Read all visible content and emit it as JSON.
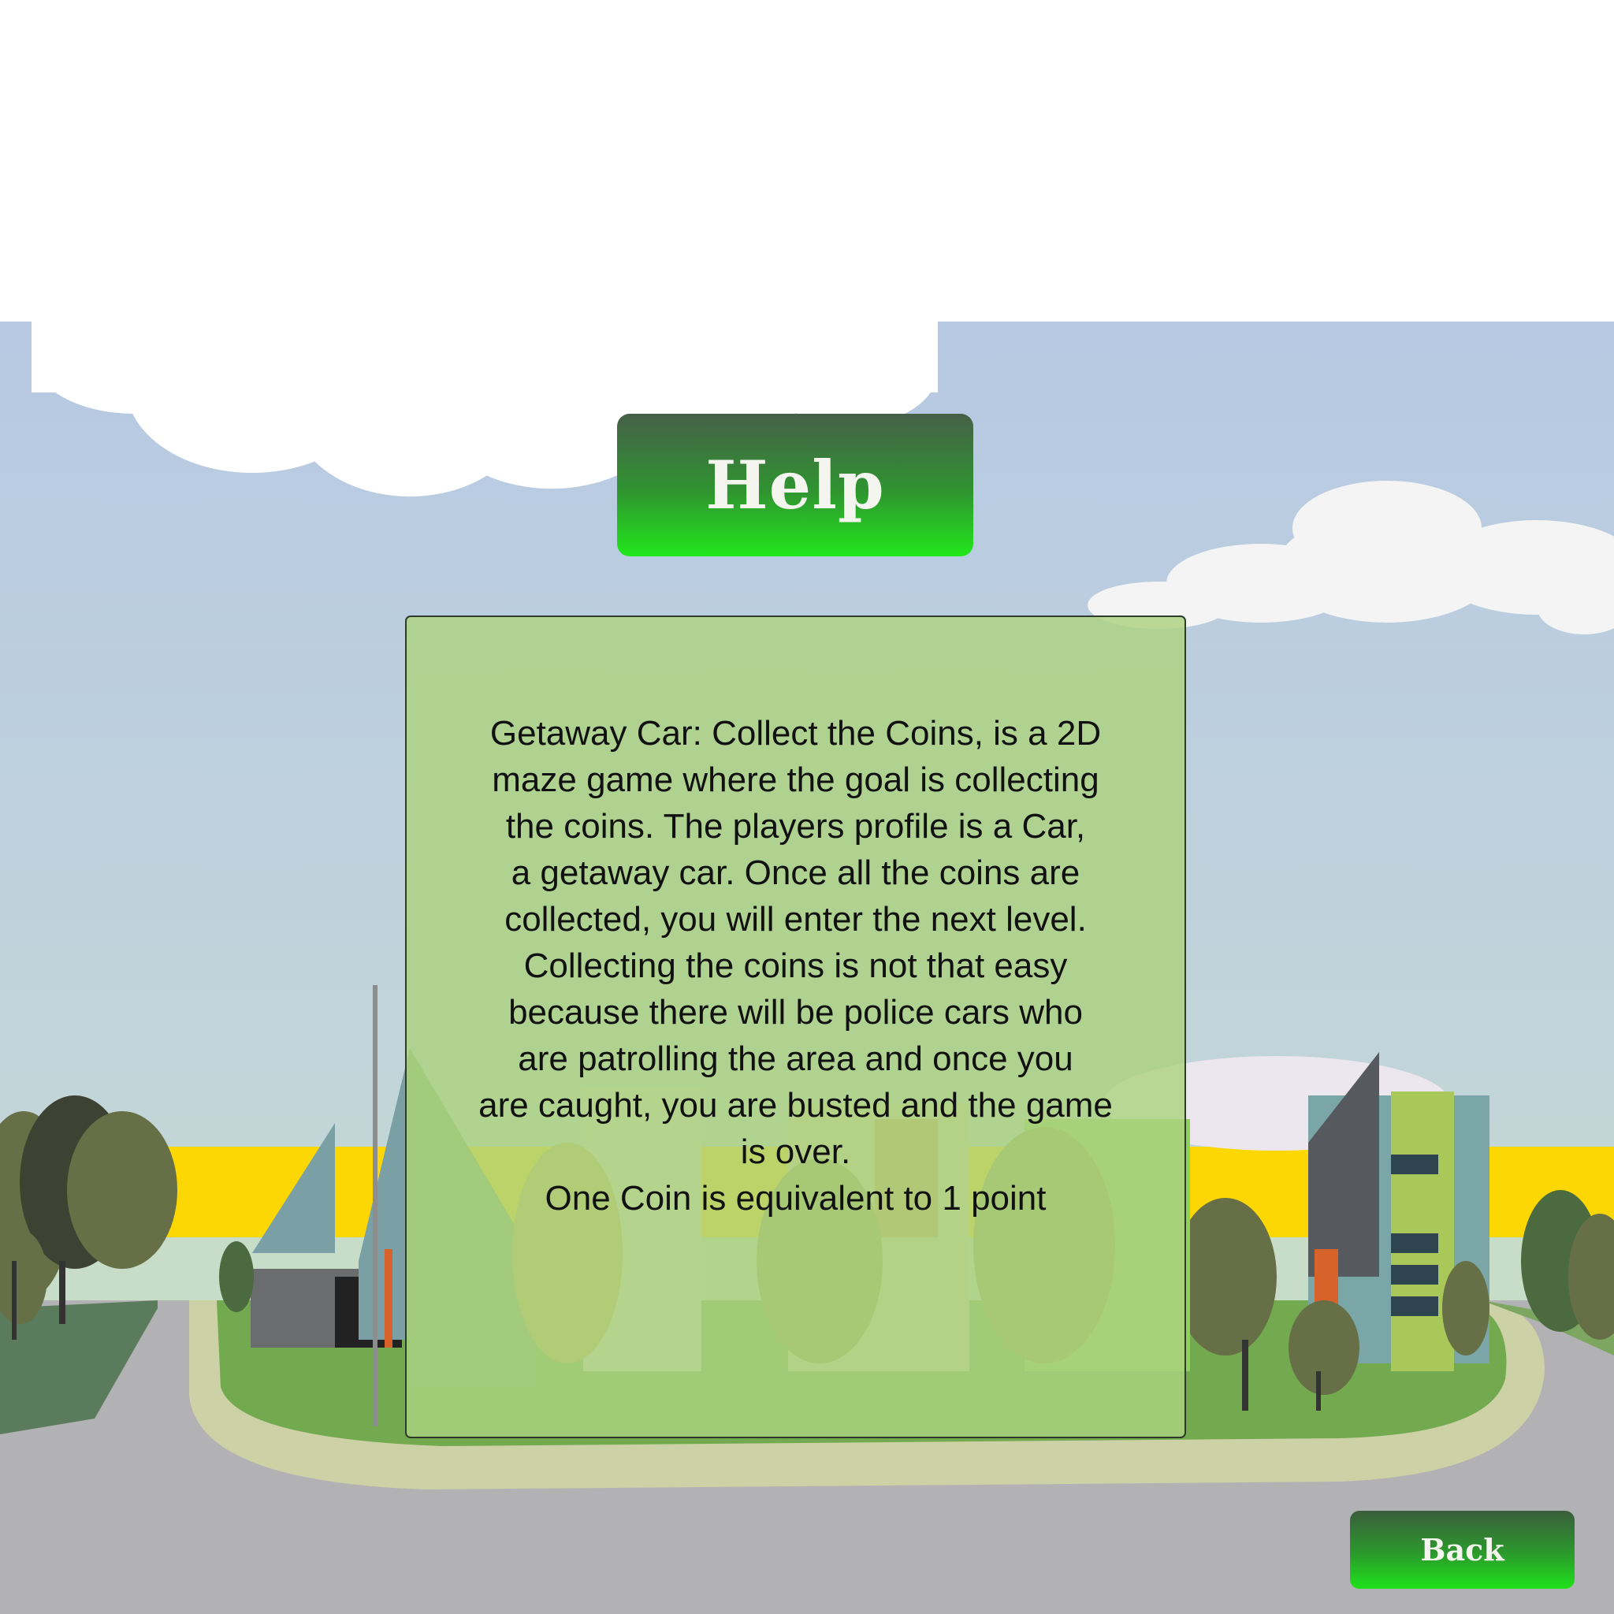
{
  "screen": {
    "title": "Help",
    "help_text": "Getaway Car: Collect the Coins, is a 2D\nmaze game where the goal is collecting\nthe coins. The players profile is a Car,\na getaway car. Once all the coins  are\ncollected, you will enter the next level.\nCollecting the coins is not that easy\nbecause there will be police cars who\nare patrolling the area and once you\nare caught, you are busted and the game\nis over.\nOne Coin is equivalent to 1 point",
    "back_label": "Back"
  },
  "colors": {
    "sky_top": "#b8c8e2",
    "sky_bottom": "#c8ddd6",
    "button_dark": "#465f48",
    "button_bright": "#22e81c",
    "panel": "#acd280",
    "road": "#b2b2b4",
    "grass": "#73aa4f",
    "horizon_band": "#fcd703"
  }
}
